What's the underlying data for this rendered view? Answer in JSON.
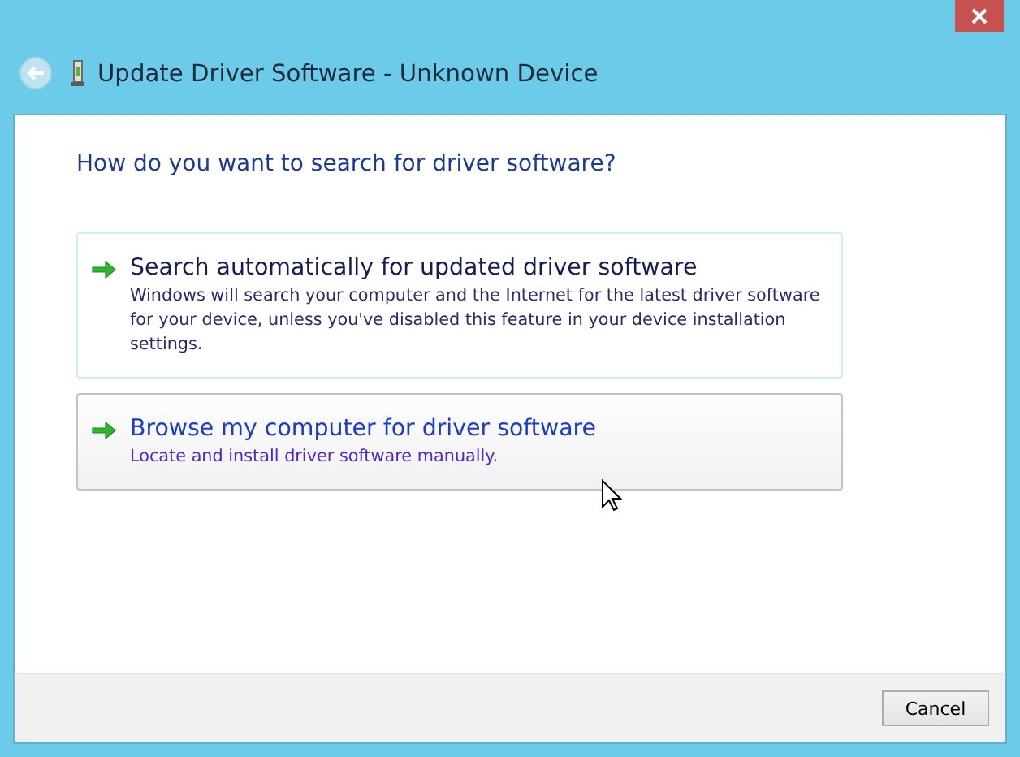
{
  "window": {
    "title": "Update Driver Software - Unknown Device",
    "back_disabled": true
  },
  "heading": "How do you want to search for driver software?",
  "options": [
    {
      "title": "Search automatically for updated driver software",
      "description": "Windows will search your computer and the Internet for the latest driver software for your device, unless you've disabled this feature in your device installation settings.",
      "hovered": false
    },
    {
      "title": "Browse my computer for driver software",
      "description": "Locate and install driver software manually.",
      "hovered": true
    }
  ],
  "buttons": [
    "Cancel"
  ]
}
